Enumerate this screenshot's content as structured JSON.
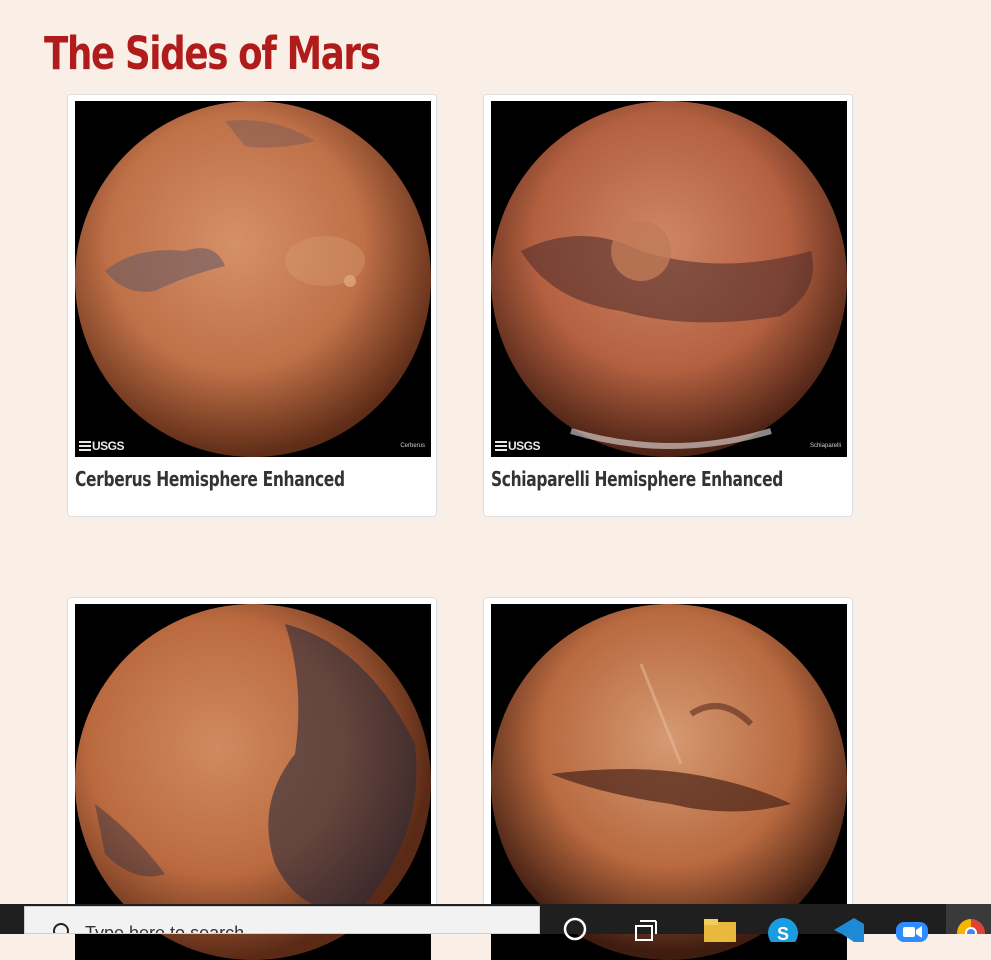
{
  "page": {
    "title": "The Sides of Mars"
  },
  "cards": [
    {
      "caption": "Cerberus Hemisphere Enhanced",
      "logo": "USGS",
      "label": "Cerberus"
    },
    {
      "caption": "Schiaparelli Hemisphere Enhanced",
      "logo": "USGS",
      "label": "Schiaparelli"
    },
    {
      "caption": "",
      "logo": "",
      "label": ""
    },
    {
      "caption": "",
      "logo": "",
      "label": ""
    }
  ],
  "taskbar": {
    "search_placeholder": "Type here to search",
    "icons": [
      "cortana-icon",
      "task-view-icon",
      "file-explorer-icon",
      "skype-icon",
      "vscode-icon",
      "zoom-icon",
      "chrome-icon"
    ]
  },
  "colors": {
    "title": "#b01c1c",
    "background": "#faefe6",
    "mars": "#c26a42"
  }
}
